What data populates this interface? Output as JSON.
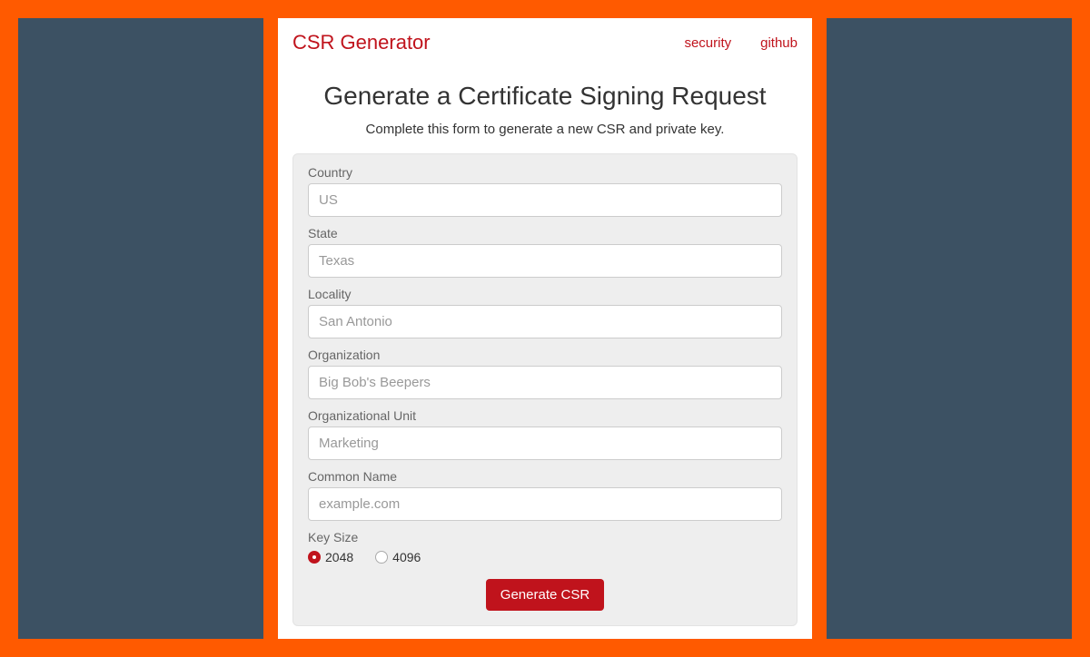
{
  "header": {
    "brand": "CSR Generator",
    "links": [
      {
        "label": "security"
      },
      {
        "label": "github"
      }
    ]
  },
  "page": {
    "title": "Generate a Certificate Signing Request",
    "subtitle": "Complete this form to generate a new CSR and private key."
  },
  "form": {
    "fields": {
      "country": {
        "label": "Country",
        "placeholder": "US",
        "value": ""
      },
      "state": {
        "label": "State",
        "placeholder": "Texas",
        "value": ""
      },
      "locality": {
        "label": "Locality",
        "placeholder": "San Antonio",
        "value": ""
      },
      "organization": {
        "label": "Organization",
        "placeholder": "Big Bob's Beepers",
        "value": ""
      },
      "organizational_unit": {
        "label": "Organizational Unit",
        "placeholder": "Marketing",
        "value": ""
      },
      "common_name": {
        "label": "Common Name",
        "placeholder": "example.com",
        "value": ""
      }
    },
    "key_size": {
      "label": "Key Size",
      "options": [
        {
          "label": "2048",
          "value": 2048,
          "selected": true
        },
        {
          "label": "4096",
          "value": 4096,
          "selected": false
        }
      ]
    },
    "submit_label": "Generate CSR"
  },
  "colors": {
    "accent": "#c0131c",
    "frame": "#ff5a00",
    "side": "#3c5163",
    "well": "#eeeeee"
  }
}
